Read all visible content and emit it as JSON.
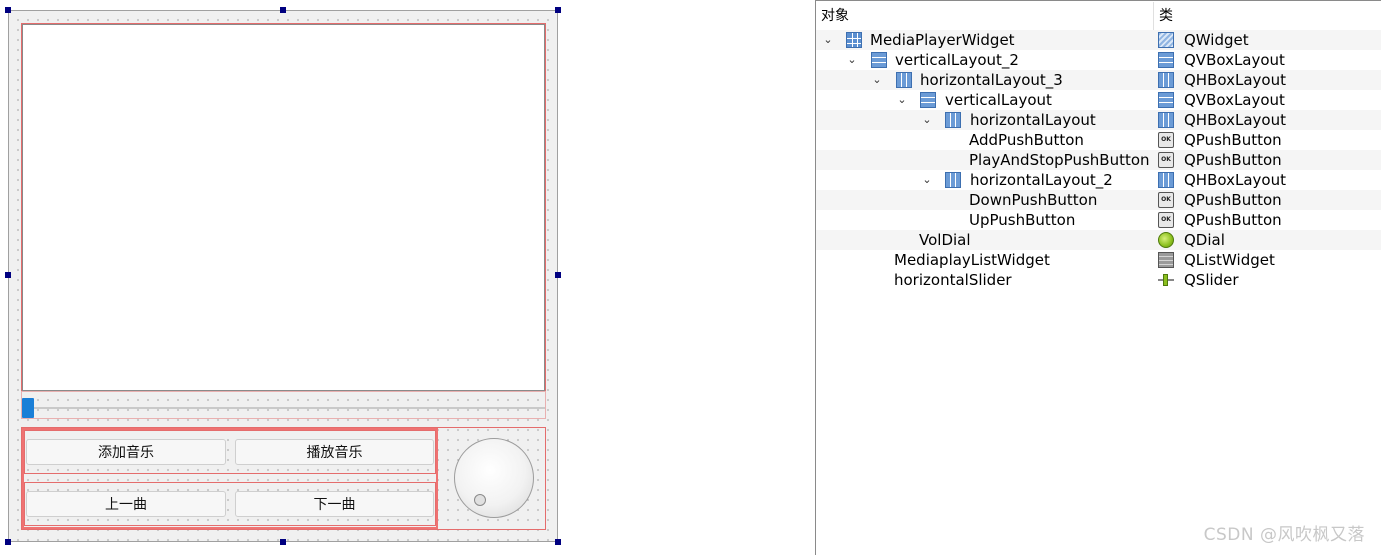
{
  "form": {
    "buttons": {
      "add": "添加音乐",
      "play": "播放音乐",
      "prev": "上一曲",
      "next": "下一曲"
    },
    "slider_value_fraction": 0.0
  },
  "inspector": {
    "header_object": "对象",
    "header_class": "类",
    "rows": [
      {
        "name": "MediaPlayerWidget",
        "class": "QWidget",
        "icon": "grid-layout-icon",
        "class_icon": "widget-icon"
      },
      {
        "name": "verticalLayout_2",
        "class": "QVBoxLayout",
        "icon": "vbox-icon",
        "class_icon": "vbox-icon"
      },
      {
        "name": "horizontalLayout_3",
        "class": "QHBoxLayout",
        "icon": "hbox-icon",
        "class_icon": "hbox-icon"
      },
      {
        "name": "verticalLayout",
        "class": "QVBoxLayout",
        "icon": "vbox-icon",
        "class_icon": "vbox-icon"
      },
      {
        "name": "horizontalLayout",
        "class": "QHBoxLayout",
        "icon": "hbox-icon",
        "class_icon": "hbox-icon"
      },
      {
        "name": "AddPushButton",
        "class": "QPushButton",
        "icon": "",
        "class_icon": "push-button-icon"
      },
      {
        "name": "PlayAndStopPushButton",
        "class": "QPushButton",
        "icon": "",
        "class_icon": "push-button-icon"
      },
      {
        "name": "horizontalLayout_2",
        "class": "QHBoxLayout",
        "icon": "hbox-icon",
        "class_icon": "hbox-icon"
      },
      {
        "name": "DownPushButton",
        "class": "QPushButton",
        "icon": "",
        "class_icon": "push-button-icon"
      },
      {
        "name": "UpPushButton",
        "class": "QPushButton",
        "icon": "",
        "class_icon": "push-button-icon"
      },
      {
        "name": "VolDial",
        "class": "QDial",
        "icon": "",
        "class_icon": "dial-icon"
      },
      {
        "name": "MediaplayListWidget",
        "class": "QListWidget",
        "icon": "",
        "class_icon": "list-widget-icon"
      },
      {
        "name": "horizontalSlider",
        "class": "QSlider",
        "icon": "",
        "class_icon": "slider-icon"
      }
    ],
    "ok_glyph": "OK"
  },
  "watermark": "CSDN @风吹枫又落"
}
